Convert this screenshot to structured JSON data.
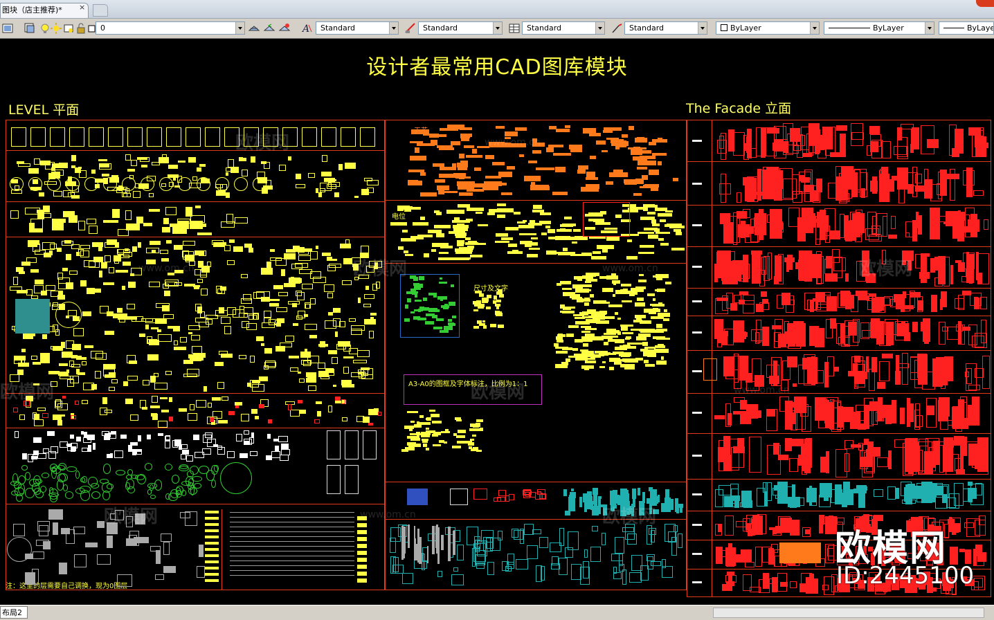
{
  "window": {
    "tab_title": "图块（店主推荐)*",
    "tab_close": "×"
  },
  "toolbar": {
    "layer_value": "0",
    "text_style": "Standard",
    "dim_style": "Standard",
    "table_style": "Standard",
    "multileader_style": "Standard",
    "color": "ByLayer",
    "linetype": "ByLayer",
    "lineweight": "ByLaye"
  },
  "drawing": {
    "title": "设计者最常用CAD图库模块",
    "plan_label": "LEVEL 平面",
    "facade_label": "The Facade   立面",
    "ceiling_label": "天花",
    "electric_label": "电位",
    "size_label": "尺寸及文字",
    "frame_note": "A3-A0的图框及字体标注，比例为1：1",
    "layer_note": "注：这里的层需要自己调换，现为0图层"
  },
  "status": {
    "layout_tab": "布局2"
  },
  "watermarks": {
    "brand": "欧模网",
    "url": "www.om.cn",
    "brand_big": "欧模网",
    "id": "ID:2445100"
  },
  "colors": {
    "frame": "#e03a1a",
    "text_yellow": "#ffff44",
    "orange": "#ff7a1a",
    "red": "#ff2020",
    "green": "#33cc33",
    "cyan": "#20b0b0"
  }
}
